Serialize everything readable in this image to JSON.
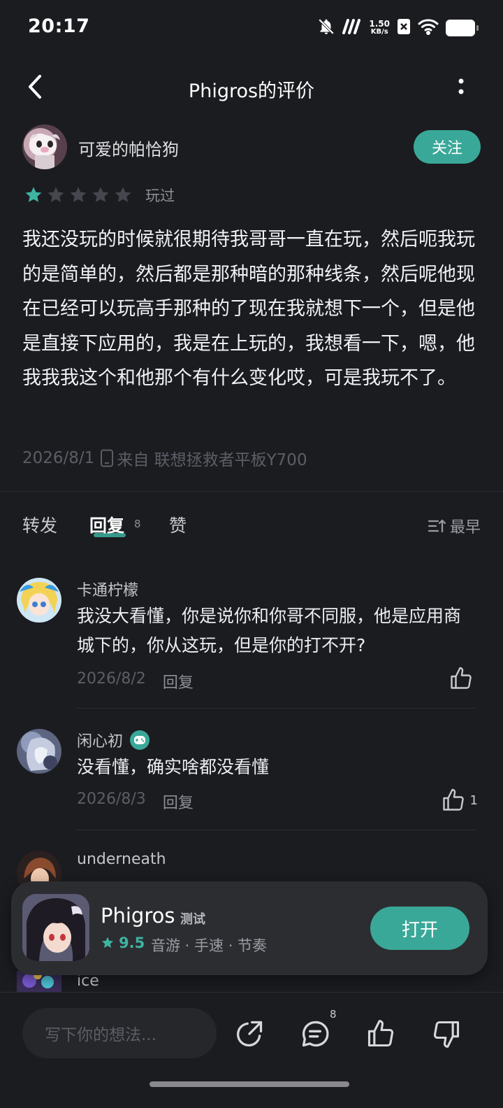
{
  "status_bar": {
    "time": "20:17",
    "speed_value": "1.50",
    "speed_unit": "KB/s",
    "icons": [
      "mute-bell-icon",
      "signal-icon",
      "sim-x-icon",
      "wifi-icon",
      "battery-icon"
    ]
  },
  "header": {
    "title": "Phigros的评价",
    "back_icon": "chevron-left-icon",
    "more_icon": "more-vertical-icon"
  },
  "review": {
    "author": "可爱的帕恰狗",
    "follow_label": "关注",
    "rating": 1,
    "rating_max": 5,
    "played_label": "玩过",
    "text": "我还没玩的时候就很期待我哥哥一直在玩，然后呃我玩的是简单的，然后都是那种暗的那种线条，然后呢他现在已经可以玩高手那种的了现在我就想下一个，但是他是直接下应用的，我是在上玩的，我想看一下，嗯，他我我我这个和他那个有什么变化哎，可是我玩不了。",
    "date": "2026/8/1",
    "source": "来自 联想拯救者平板Y700"
  },
  "tabs": {
    "repost": "转发",
    "reply": "回复",
    "reply_count": "8",
    "like": "赞",
    "sort_label": "最早"
  },
  "comments": [
    {
      "name": "卡通柠檬",
      "text": "我没大看懂，你是说你和你哥不同服，他是应用商城下的，你从这玩，但是你的打不开?",
      "date": "2026/8/2",
      "reply_label": "回复",
      "likes": ""
    },
    {
      "name": "闲心初",
      "text": "没看懂，确实啥都没看懂",
      "date": "2026/8/3",
      "reply_label": "回复",
      "likes": "1"
    },
    {
      "name": "underneath"
    },
    {
      "name": "ice"
    }
  ],
  "app_card": {
    "name": "Phigros",
    "tag": "测试",
    "score": "9.5",
    "categories": "音游 · 手速 · 节奏",
    "open_label": "打开"
  },
  "bottom_bar": {
    "input_placeholder": "写下你的想法...",
    "comment_count": "8"
  },
  "colors": {
    "accent": "#3aa898",
    "background": "#1b1c20"
  }
}
